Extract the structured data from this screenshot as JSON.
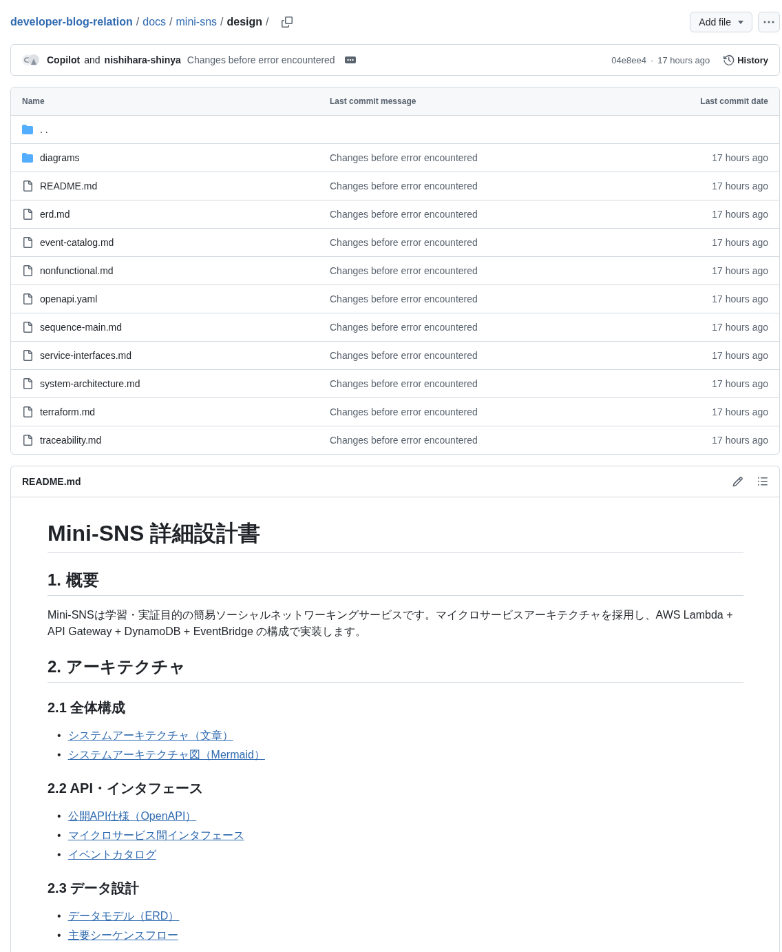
{
  "breadcrumb": {
    "repo": "developer-blog-relation",
    "parts": [
      "docs",
      "mini-sns"
    ],
    "current": "design",
    "separator": "/"
  },
  "actions": {
    "add_file": "Add file"
  },
  "commit": {
    "author1": "Copilot",
    "joiner": "and",
    "author2": "nishihara-shinya",
    "message": "Changes before error encountered",
    "sha": "04e8ee4",
    "dot": "·",
    "time": "17 hours ago",
    "history": "History"
  },
  "table": {
    "columns": [
      "Name",
      "Last commit message",
      "Last commit date"
    ],
    "rows": [
      {
        "kind": "parent",
        "name": ". ."
      },
      {
        "kind": "folder",
        "name": "diagrams",
        "message": "Changes before error encountered",
        "date": "17 hours ago"
      },
      {
        "kind": "file",
        "name": "README.md",
        "message": "Changes before error encountered",
        "date": "17 hours ago"
      },
      {
        "kind": "file",
        "name": "erd.md",
        "message": "Changes before error encountered",
        "date": "17 hours ago"
      },
      {
        "kind": "file",
        "name": "event-catalog.md",
        "message": "Changes before error encountered",
        "date": "17 hours ago"
      },
      {
        "kind": "file",
        "name": "nonfunctional.md",
        "message": "Changes before error encountered",
        "date": "17 hours ago"
      },
      {
        "kind": "file",
        "name": "openapi.yaml",
        "message": "Changes before error encountered",
        "date": "17 hours ago"
      },
      {
        "kind": "file",
        "name": "sequence-main.md",
        "message": "Changes before error encountered",
        "date": "17 hours ago"
      },
      {
        "kind": "file",
        "name": "service-interfaces.md",
        "message": "Changes before error encountered",
        "date": "17 hours ago"
      },
      {
        "kind": "file",
        "name": "system-architecture.md",
        "message": "Changes before error encountered",
        "date": "17 hours ago"
      },
      {
        "kind": "file",
        "name": "terraform.md",
        "message": "Changes before error encountered",
        "date": "17 hours ago"
      },
      {
        "kind": "file",
        "name": "traceability.md",
        "message": "Changes before error encountered",
        "date": "17 hours ago"
      }
    ]
  },
  "readme": {
    "title": "README.md",
    "blocks": [
      {
        "kind": "h1",
        "text": "Mini-SNS 詳細設計書"
      },
      {
        "kind": "h2",
        "text": "1. 概要"
      },
      {
        "kind": "p",
        "text": "Mini-SNSは学習・実証目的の簡易ソーシャルネットワーキングサービスです。マイクロサービスアーキテクチャを採用し、AWS Lambda + API Gateway + DynamoDB + EventBridge の構成で実装します。"
      },
      {
        "kind": "h2",
        "text": "2. アーキテクチャ"
      },
      {
        "kind": "h3",
        "text": "2.1 全体構成"
      },
      {
        "kind": "ul",
        "bullet": "•",
        "items": [
          "システムアーキテクチャ（文章）",
          "システムアーキテクチャ図（Mermaid）"
        ]
      },
      {
        "kind": "h3",
        "text": "2.2 API・インタフェース"
      },
      {
        "kind": "ul",
        "bullet": "•",
        "items": [
          "公開API仕様（OpenAPI）",
          "マイクロサービス間インタフェース",
          "イベントカタログ"
        ]
      },
      {
        "kind": "h3",
        "text": "2.3 データ設計"
      },
      {
        "kind": "ul",
        "bullet": "•",
        "items": [
          "データモデル（ERD）",
          "主要シーケンスフロー"
        ]
      }
    ]
  }
}
